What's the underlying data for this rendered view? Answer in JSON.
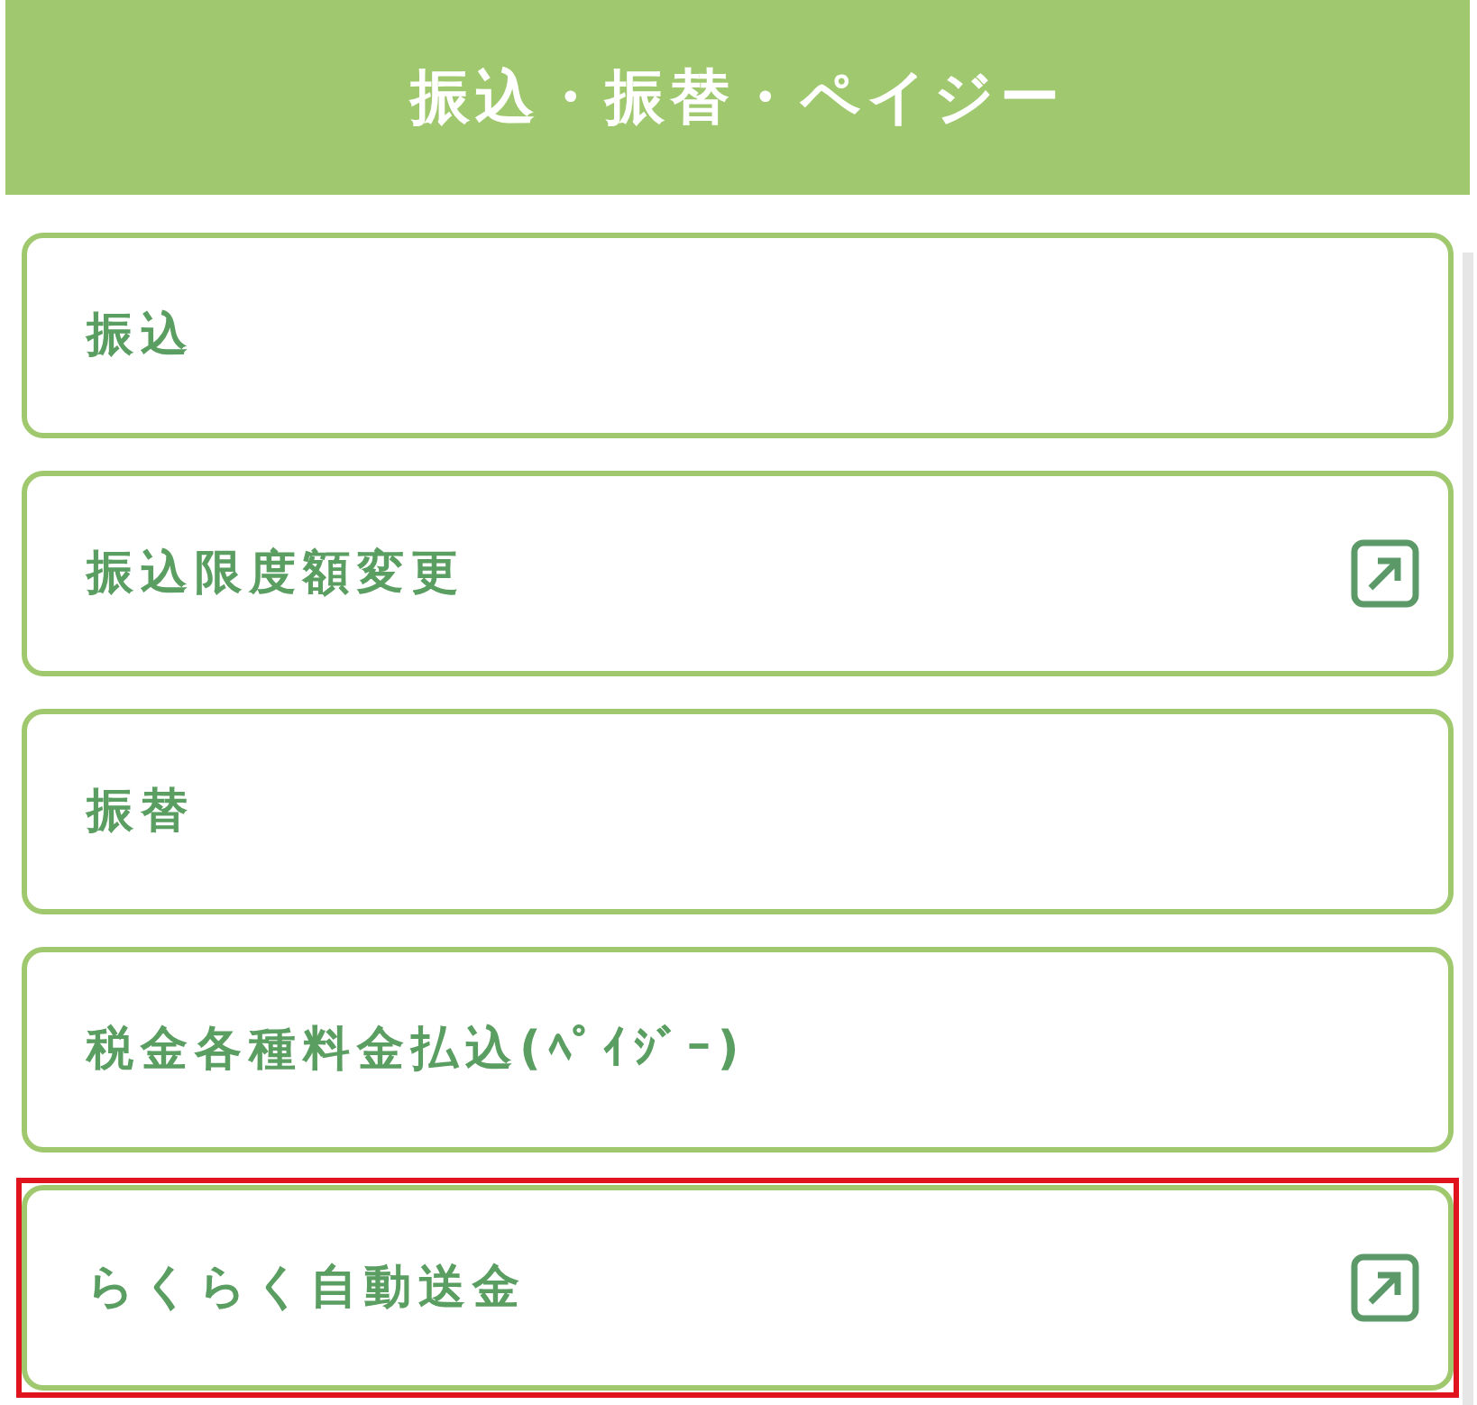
{
  "header": {
    "title": "振込・振替・ペイジー"
  },
  "items": [
    {
      "label": "振込",
      "external": false,
      "highlighted": false
    },
    {
      "label": "振込限度額変更",
      "external": true,
      "highlighted": false
    },
    {
      "label": "振替",
      "external": false,
      "highlighted": false
    },
    {
      "label": "税金各種料金払込(ﾍﾟｲｼﾞｰ)",
      "external": false,
      "highlighted": false
    },
    {
      "label": "らくらく自動送金",
      "external": true,
      "highlighted": true
    }
  ]
}
